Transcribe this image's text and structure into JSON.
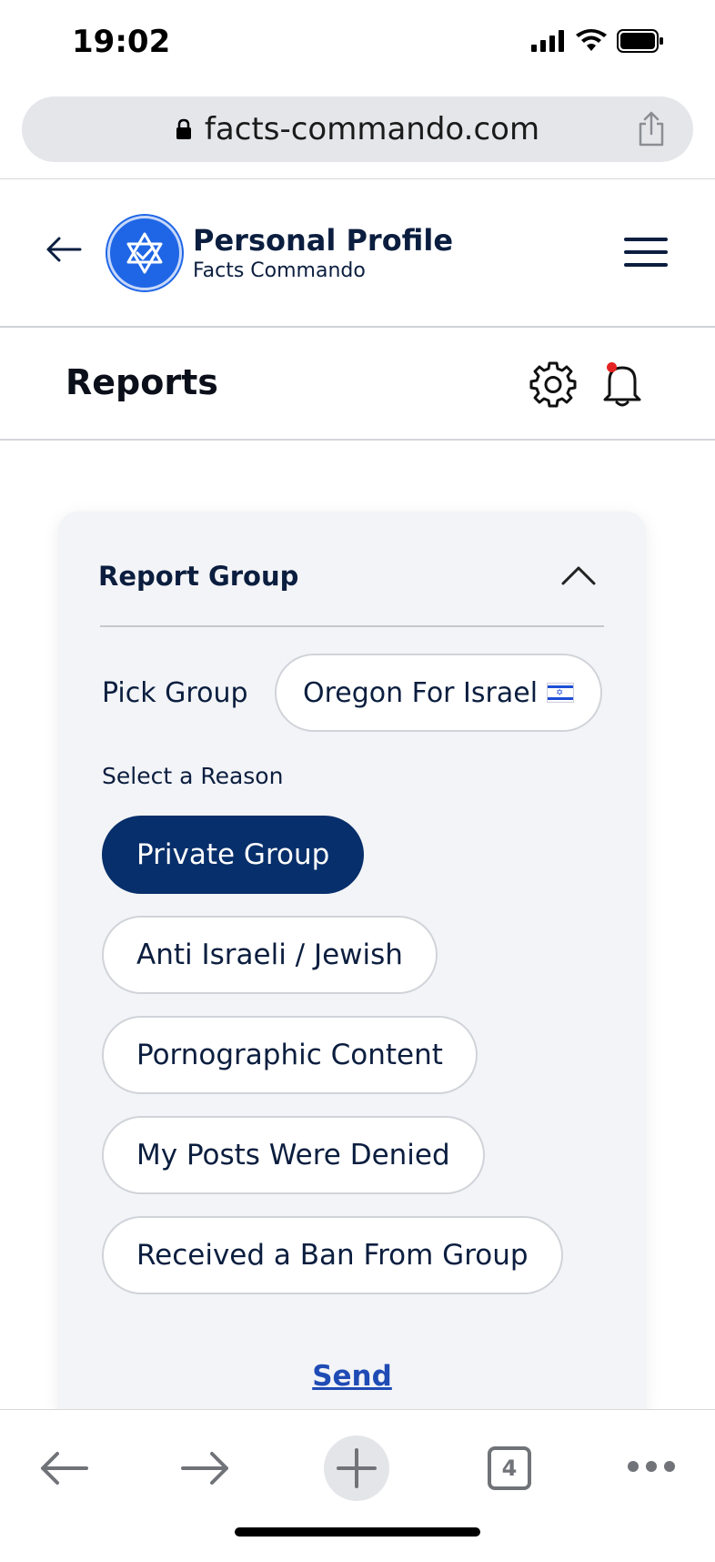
{
  "status_bar": {
    "time": "19:02"
  },
  "browser": {
    "url": "facts-commando.com",
    "tab_count": "4"
  },
  "app_header": {
    "title": "Personal Profile",
    "subtitle": "Facts Commando"
  },
  "page": {
    "title": "Reports"
  },
  "card": {
    "title": "Report Group",
    "pick_label": "Pick Group",
    "selected_group": "Oregon For Israel",
    "reason_label": "Select a Reason",
    "reasons": [
      {
        "label": "Private Group",
        "selected": true
      },
      {
        "label": "Anti Israeli / Jewish",
        "selected": false
      },
      {
        "label": "Pornographic Content",
        "selected": false
      },
      {
        "label": "My Posts Were Denied",
        "selected": false
      },
      {
        "label": "Received a Ban From Group",
        "selected": false
      }
    ],
    "send_label": "Send"
  },
  "colors": {
    "primary": "#072f6b",
    "brand_blue": "#1f66e6",
    "link": "#1f4bb5",
    "notification": "#e52222"
  },
  "icons": [
    "back-arrow-icon",
    "star-of-david-logo-icon",
    "hamburger-menu-icon",
    "gear-icon",
    "bell-icon",
    "chevron-up-icon",
    "lock-icon",
    "share-icon",
    "israel-flag-icon",
    "browser-back-icon",
    "browser-forward-icon",
    "new-tab-plus-icon",
    "tabs-count-icon",
    "more-dots-icon"
  ]
}
